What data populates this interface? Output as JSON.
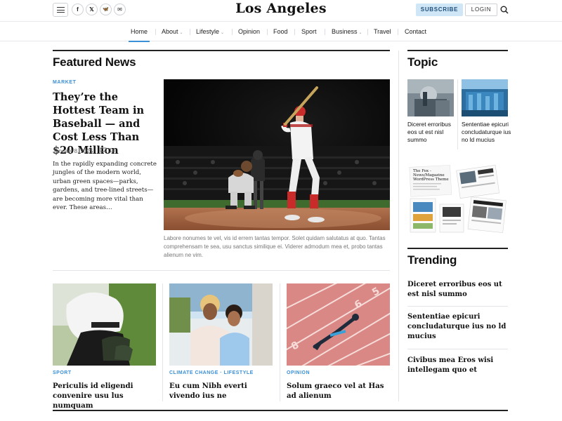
{
  "header": {
    "logo": "Los Angeles",
    "subscribe_label": "SUBSCRIBE",
    "login_label": "LOGIN",
    "icons": [
      "menu-icon",
      "facebook-icon",
      "x-icon",
      "bluesky-icon",
      "email-icon",
      "search-icon"
    ],
    "social_glyphs": {
      "facebook": "f",
      "x": "𝕏",
      "bluesky": "🦋",
      "email": "✉"
    }
  },
  "nav": {
    "items": [
      {
        "label": "Home",
        "active": true
      },
      {
        "label": "About",
        "dropdown": true
      },
      {
        "label": "Lifestyle",
        "dropdown": true
      },
      {
        "label": "Opinion"
      },
      {
        "label": "Food"
      },
      {
        "label": "Sport"
      },
      {
        "label": "Business",
        "dropdown": true
      },
      {
        "label": "Travel"
      },
      {
        "label": "Contact"
      }
    ],
    "dropdown_glyph": "⌄"
  },
  "featured": {
    "title": "Featured News",
    "lead": {
      "category": "MARKET",
      "headline": "They’re the Hottest Team in Baseball — and Cost Less Than $20 Million",
      "date": "January 8, 2025",
      "comments": "16",
      "excerpt": "In the rapidly expanding concrete jungles of the modern world, urban green spaces—parks, gardens, and tree-lined streets—are becoming more vital than ever. These areas…",
      "caption": "Labore nonumes te vel, vis id errem tantas tempor. Solet quidam salutatus at quo. Tantas comprehensam te sea, usu sanctus similique ei. Viderer admodum mea et, probo tantas alienum ne vim."
    },
    "cards": [
      {
        "category": "SPORT",
        "title": "Periculis id eligendi convenire usu lus numquam"
      },
      {
        "category": "CLIMATE CHANGE · LIFESTYLE",
        "title": "Eu cum Nibh everti vivendo ius ne"
      },
      {
        "category": "OPINION",
        "title": "Solum graeco vel at Has ad alienum"
      }
    ]
  },
  "sidebar": {
    "topic_title": "Topic",
    "topics": [
      {
        "title": "Diceret erroribus eos ut est nisl summo"
      },
      {
        "title": "Sententiae epicuri concludaturque ius no ld mucius"
      }
    ],
    "promo": {
      "line1": "The Fox -",
      "line2": "News/Magazine",
      "line3": "WordPress Theme"
    },
    "trending_title": "Trending",
    "trending": [
      {
        "title": "Diceret erroribus eos ut est nisl summo"
      },
      {
        "title": "Sententiae epicuri concludaturque ius no ld mucius"
      },
      {
        "title": "Civibus mea Eros wisi intellegam quo et"
      }
    ]
  },
  "colors": {
    "accent": "#3b8fd6",
    "subscribe_bg": "#cfe6f7",
    "text": "#111111",
    "muted": "#777777"
  }
}
